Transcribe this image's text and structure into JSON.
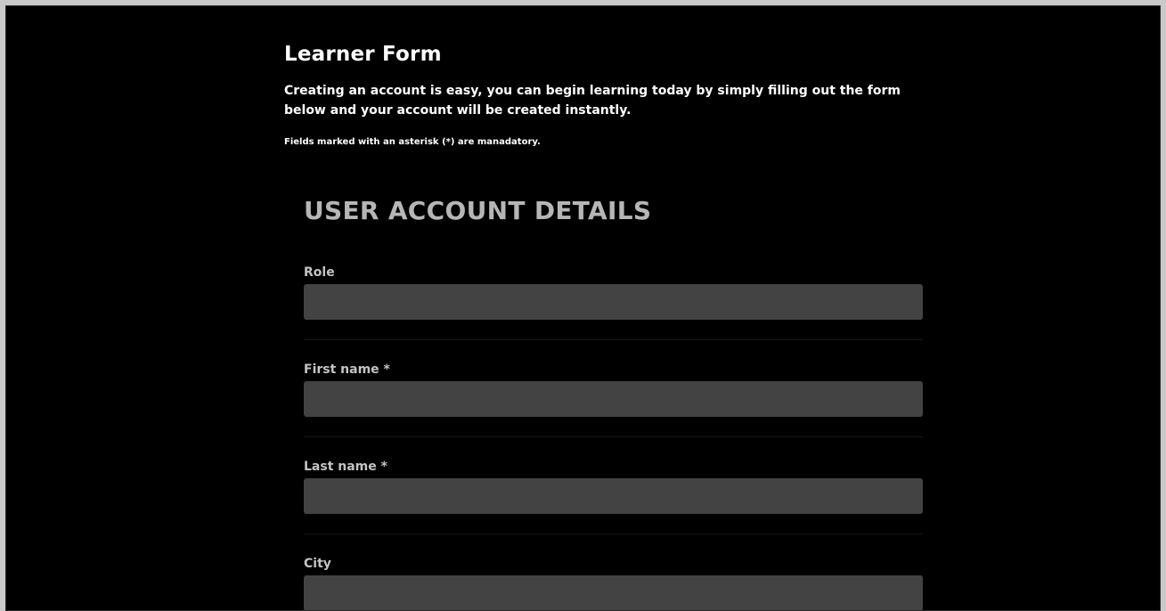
{
  "page": {
    "title": "Learner Form",
    "intro": "Creating an account is easy, you can begin learning today by simply filling out the form below and your account will be created instantly.",
    "mandatory_note": "Fields marked with an asterisk (*) are manadatory."
  },
  "form": {
    "section_heading": "USER ACCOUNT DETAILS",
    "fields": [
      {
        "label": "Role",
        "value": "",
        "placeholder": ""
      },
      {
        "label": "First name *",
        "value": "",
        "placeholder": ""
      },
      {
        "label": "Last name *",
        "value": "",
        "placeholder": ""
      },
      {
        "label": "City",
        "value": "",
        "placeholder": ""
      }
    ]
  },
  "colors": {
    "background": "#000000",
    "outer_border": "#c9c9c9",
    "heading_text": "#ffffff",
    "section_heading": "#b6b6b6",
    "label_text": "#c4c4c4",
    "input_background": "#434343"
  }
}
